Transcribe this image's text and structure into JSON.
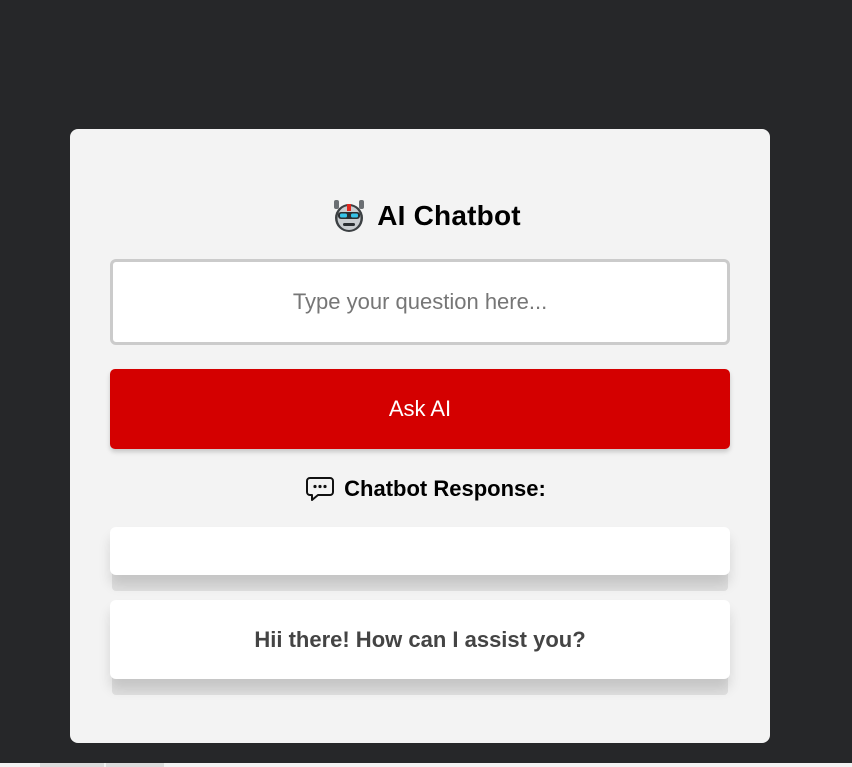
{
  "app": {
    "title": "AI Chatbot",
    "title_icon": "robot-face-icon"
  },
  "input": {
    "placeholder": "Type your question here...",
    "value": ""
  },
  "actions": {
    "ask_label": "Ask AI"
  },
  "response": {
    "heading": "Chatbot Response:",
    "heading_icon": "speech-bubble-icon",
    "empty_text": "",
    "message": "Hii there! How can I assist you?"
  },
  "colors": {
    "background": "#262729",
    "card": "#f3f3f3",
    "accent": "#d40000",
    "input_border": "#cbcbcb",
    "response_text": "#444444"
  }
}
